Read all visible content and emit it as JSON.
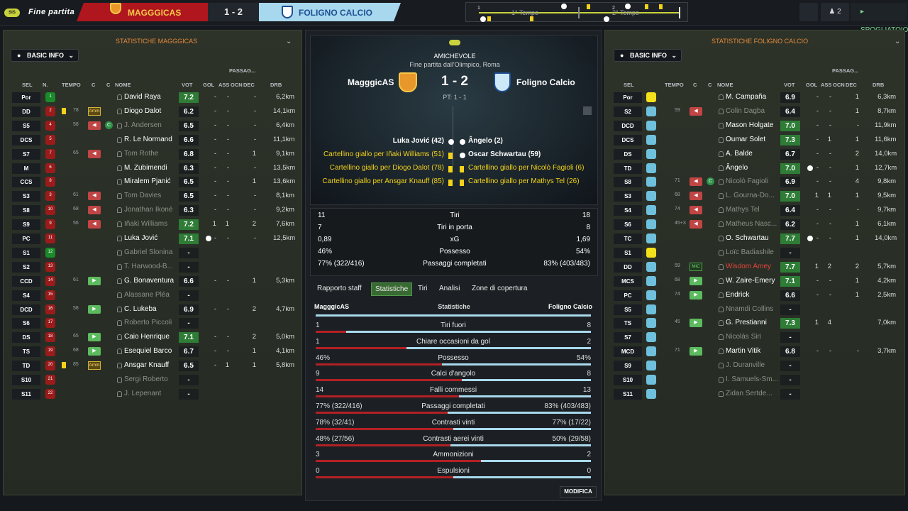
{
  "topbar": {
    "logo_text": "SIS",
    "stage": "Fine partita",
    "home_team": "MAGGGICAS",
    "score": "1 - 2",
    "away_team": "FOLIGNO CALCIO",
    "first_half": "1° Tempo",
    "second_half": "2° Tempo",
    "half_marks": [
      "1",
      "2"
    ],
    "squad_count": "2",
    "dressing_room": "SPOGLIATOIO"
  },
  "left_panel": {
    "title": "STATISTICHE MAGGGICAS",
    "basic_info": "BASIC INFO",
    "headers": {
      "sel": "SEL",
      "n": "N.",
      "tempo": "TEMPO",
      "c1": "C",
      "c2": "C",
      "nome": "NOME",
      "vot": "VOT",
      "passag": "PASSAG...",
      "gol": "GOL",
      "ass": "ASS",
      "ocn": "OCN",
      "dec": "DEC",
      "drb": "DRB"
    },
    "rows": [
      {
        "pos": "Por",
        "n": "1",
        "name": "David Raya",
        "vot": "7.2",
        "gol": "-",
        "ass": "-",
        "dec": "-",
        "drb": "6,2km",
        "dim": false,
        "hi": true,
        "gk": true
      },
      {
        "pos": "DD",
        "n": "2",
        "min": "78",
        "card": true,
        "tag": "Amm",
        "name": "Diogo Dalot",
        "vot": "6.2",
        "gol": "-",
        "ass": "-",
        "dec": "-",
        "drb": "14,1km",
        "dim": false
      },
      {
        "pos": "S5",
        "n": "4",
        "sub": "out",
        "min": "58",
        "btn": "out",
        "cicon": true,
        "cicon_text": "C",
        "name": "J. Andersen",
        "vot": "6.5",
        "gol": "-",
        "ass": "-",
        "dec": "-",
        "drb": "6,4km",
        "dim": true
      },
      {
        "pos": "DCS",
        "n": "5",
        "name": "R. Le Normand",
        "vot": "6.6",
        "gol": "-",
        "ass": "-",
        "dec": "-",
        "drb": "11,1km",
        "dim": false
      },
      {
        "pos": "S7",
        "n": "7",
        "sub": "out",
        "min": "65",
        "btn": "out",
        "name": "Tom Rothe",
        "vot": "6.8",
        "gol": "-",
        "ass": "-",
        "dec": "1",
        "drb": "9,1km",
        "dim": true
      },
      {
        "pos": "M",
        "n": "6",
        "name": "M. Zubimendi",
        "vot": "6.3",
        "gol": "-",
        "ass": "-",
        "dec": "-",
        "drb": "13,5km",
        "dim": false
      },
      {
        "pos": "CCS",
        "n": "8",
        "name": "Miralem Pjanić",
        "vot": "6.5",
        "gol": "-",
        "ass": "-",
        "dec": "1",
        "drb": "13,6km",
        "dim": false
      },
      {
        "pos": "S3",
        "n": "3",
        "sub": "out",
        "min": "61",
        "btn": "out",
        "name": "Tom Davies",
        "vot": "6.5",
        "gol": "-",
        "ass": "-",
        "dec": "-",
        "drb": "8,1km",
        "dim": true
      },
      {
        "pos": "S8",
        "n": "10",
        "sub": "out",
        "min": "68",
        "btn": "out",
        "name": "Jonathan Ikoné",
        "vot": "6.3",
        "gol": "-",
        "ass": "-",
        "dec": "-",
        "drb": "9,2km",
        "dim": true
      },
      {
        "pos": "S9",
        "n": "9",
        "sub": "out",
        "min": "56",
        "btn": "out",
        "name": "Iñaki Williams",
        "vot": "7.2",
        "gol": "1",
        "ass": "1",
        "dec": "2",
        "drb": "7,6km",
        "dim": true,
        "hi": true
      },
      {
        "pos": "PC",
        "n": "11",
        "ball": true,
        "name": "Luka Jović",
        "vot": "7.1",
        "gol": "-",
        "ass": "-",
        "dec": "-",
        "drb": "12,5km",
        "dim": false,
        "hi": true
      },
      {
        "pos": "S1",
        "n": "12",
        "name": "Gabriel Slonina",
        "vot": "-",
        "gol": "",
        "ass": "",
        "dec": "",
        "drb": "",
        "dim": true,
        "gk": true
      },
      {
        "pos": "S2",
        "n": "13",
        "name": "T. Harwood-B...",
        "vot": "-",
        "gol": "",
        "ass": "",
        "dec": "",
        "drb": "",
        "dim": true
      },
      {
        "pos": "CCD",
        "n": "14",
        "sub": "in",
        "min": "61",
        "btn": "in",
        "name": "G. Bonaventura",
        "vot": "6.6",
        "gol": "-",
        "ass": "-",
        "dec": "1",
        "drb": "5,3km",
        "dim": false
      },
      {
        "pos": "S4",
        "n": "15",
        "name": "Alassane Pléa",
        "vot": "-",
        "gol": "",
        "ass": "",
        "dec": "",
        "drb": "",
        "dim": true
      },
      {
        "pos": "DCD",
        "n": "16",
        "sub": "in",
        "min": "58",
        "btn": "in",
        "name": "C. Lukeba",
        "vot": "6.9",
        "gol": "-",
        "ass": "-",
        "dec": "2",
        "drb": "4,7km",
        "dim": false
      },
      {
        "pos": "S6",
        "n": "17",
        "name": "Roberto Piccoli",
        "vot": "-",
        "gol": "",
        "ass": "",
        "dec": "",
        "drb": "",
        "dim": true
      },
      {
        "pos": "DS",
        "n": "18",
        "sub": "in",
        "min": "65",
        "btn": "in",
        "name": "Caio Henrique",
        "vot": "7.1",
        "gol": "-",
        "ass": "-",
        "dec": "2",
        "drb": "5,0km",
        "dim": false,
        "hi": true
      },
      {
        "pos": "TS",
        "n": "19",
        "sub": "in",
        "min": "68",
        "btn": "in",
        "name": "Esequiel Barco",
        "vot": "6.7",
        "gol": "-",
        "ass": "-",
        "dec": "1",
        "drb": "4,1km",
        "dim": false
      },
      {
        "pos": "TD",
        "n": "20",
        "sub": "in",
        "min": "85",
        "card": true,
        "tag": "Amm",
        "name": "Ansgar Knauff",
        "vot": "6.5",
        "gol": "-",
        "ass": "1",
        "dec": "1",
        "drb": "5,8km",
        "dim": false
      },
      {
        "pos": "S10",
        "n": "21",
        "name": "Sergi Roberto",
        "vot": "-",
        "gol": "",
        "ass": "",
        "dec": "",
        "drb": "",
        "dim": true
      },
      {
        "pos": "S11",
        "n": "22",
        "name": "J. Lepenant",
        "vot": "-",
        "gol": "",
        "ass": "",
        "dec": "",
        "drb": "",
        "dim": true
      }
    ]
  },
  "right_panel": {
    "title": "STATISTICHE FOLIGNO CALCIO",
    "basic_info": "BASIC INFO",
    "headers": {
      "sel": "SEL",
      "tempo": "TEMPO",
      "c1": "C",
      "c2": "C",
      "nome": "NOME",
      "vot": "VOT",
      "passag": "PASSAG...",
      "gol": "GOL",
      "ass": "ASS",
      "ocn": "OCN",
      "dec": "DEC",
      "drb": "DRB"
    },
    "rows": [
      {
        "pos": "Por",
        "gk": true,
        "name": "M. Campaña",
        "vot": "6.9",
        "gol": "-",
        "ass": "-",
        "dec": "1",
        "drb": "6,3km",
        "dim": false
      },
      {
        "pos": "S2",
        "sub": "out",
        "min": "59",
        "btn": "out",
        "name": "Colin Dagba",
        "vot": "6.4",
        "gol": "-",
        "ass": "-",
        "dec": "1",
        "drb": "8,7km",
        "dim": true
      },
      {
        "pos": "DCD",
        "name": "Mason Holgate",
        "vot": "7.0",
        "gol": "-",
        "ass": "-",
        "dec": "-",
        "drb": "11,9km",
        "dim": false,
        "hi": true
      },
      {
        "pos": "DCS",
        "name": "Oumar Solet",
        "vot": "7.3",
        "gol": "-",
        "ass": "1",
        "dec": "1",
        "drb": "11,6km",
        "dim": false,
        "hi": true
      },
      {
        "pos": "DS",
        "name": "A. Balde",
        "vot": "6.7",
        "gol": "-",
        "ass": "-",
        "dec": "2",
        "drb": "14,0km",
        "dim": false
      },
      {
        "pos": "TD",
        "ball": true,
        "name": "Ângelo",
        "vot": "7.0",
        "gol": "-",
        "ass": "-",
        "dec": "1",
        "drb": "12,7km",
        "dim": false,
        "hi": true
      },
      {
        "pos": "S8",
        "sub": "out",
        "min": "71",
        "btn": "out",
        "cicon": true,
        "cicon_text": "C",
        "name": "Nicolò Fagioli",
        "vot": "6.9",
        "gol": "-",
        "ass": "-",
        "dec": "4",
        "drb": "9,8km",
        "dim": true
      },
      {
        "pos": "S3",
        "sub": "out",
        "min": "68",
        "btn": "out",
        "name": "L. Gourna-Do...",
        "vot": "7.0",
        "gol": "1",
        "ass": "1",
        "dec": "1",
        "drb": "9,5km",
        "dim": true,
        "hi": true
      },
      {
        "pos": "S4",
        "sub": "out",
        "min": "74",
        "btn": "out",
        "name": "Mathys Tel",
        "vot": "6.4",
        "gol": "-",
        "ass": "-",
        "dec": "-",
        "drb": "9,7km",
        "dim": true
      },
      {
        "pos": "S6",
        "sub": "out",
        "min": "45+3",
        "btn": "out",
        "name": "Matheus Nasc...",
        "vot": "6.2",
        "gol": "-",
        "ass": "-",
        "dec": "1",
        "drb": "6,1km",
        "dim": true
      },
      {
        "pos": "TC",
        "ball": true,
        "name": "O. Schwartau",
        "vot": "7.7",
        "gol": "-",
        "ass": "-",
        "dec": "1",
        "drb": "14,0km",
        "dim": false,
        "hi": true
      },
      {
        "pos": "S1",
        "gk": true,
        "name": "Loïc Badiashile",
        "vot": "-",
        "gol": "",
        "ass": "",
        "dec": "",
        "drb": "",
        "dim": true
      },
      {
        "pos": "DD",
        "sub": "in",
        "min": "59",
        "tag": "MiC",
        "name": "Wisdom Amey",
        "vot": "7.7",
        "gol": "1",
        "ass": "2",
        "dec": "2",
        "drb": "5,7km",
        "dim": false,
        "red": true,
        "hi": true
      },
      {
        "pos": "MCS",
        "sub": "in",
        "min": "68",
        "btn": "in",
        "name": "W. Zaire-Emery",
        "vot": "7.1",
        "gol": "-",
        "ass": "-",
        "dec": "1",
        "drb": "4,2km",
        "dim": false,
        "hi": true
      },
      {
        "pos": "PC",
        "sub": "in",
        "min": "74",
        "btn": "in",
        "name": "Endrick",
        "vot": "6.6",
        "gol": "-",
        "ass": "-",
        "dec": "1",
        "drb": "2,5km",
        "dim": false
      },
      {
        "pos": "S5",
        "name": "Nnamdi Collins",
        "vot": "-",
        "gol": "",
        "ass": "",
        "dec": "",
        "drb": "",
        "dim": true
      },
      {
        "pos": "TS",
        "sub": "in",
        "min": "45",
        "btn": "in",
        "name": "G. Prestianni",
        "vot": "7.3",
        "gol": "1",
        "ass": "4",
        "dec": "",
        "drb": "7,0km",
        "dim": false,
        "hi": true
      },
      {
        "pos": "S7",
        "name": "Nicolás Siri",
        "vot": "-",
        "gol": "",
        "ass": "",
        "dec": "",
        "drb": "",
        "dim": true
      },
      {
        "pos": "MCD",
        "sub": "in",
        "min": "71",
        "btn": "in",
        "name": "Martin Vitik",
        "vot": "6.8",
        "gol": "-",
        "ass": "-",
        "dec": "-",
        "drb": "3,7km",
        "dim": false
      },
      {
        "pos": "S9",
        "name": "J. Duranville",
        "vot": "-",
        "gol": "",
        "ass": "",
        "dec": "",
        "drb": "",
        "dim": true
      },
      {
        "pos": "S10",
        "name": "I. Samuels-Sm...",
        "vot": "-",
        "gol": "",
        "ass": "",
        "dec": "",
        "drb": "",
        "dim": true
      },
      {
        "pos": "S11",
        "name": "Zidan Sertde...",
        "vot": "-",
        "gol": "",
        "ass": "",
        "dec": "",
        "drb": "",
        "dim": true
      }
    ]
  },
  "center": {
    "competition": "AMICHEVOLE",
    "venue": "Fine partita dall'Olimpico, Roma",
    "home_name": "MagggicAS",
    "away_name": "Foligno Calcio",
    "score": "1 - 2",
    "ht": "PT: 1 - 1",
    "events_left": [
      "Luka Jović (42)",
      "Cartellino giallo per Iñaki Williams (51)",
      "Cartellino giallo per Diogo Dalot (78)",
      "Cartellino giallo per Ansgar Knauff (85)"
    ],
    "events_right": [
      "Ângelo (2)",
      "Oscar Schwartau (59)",
      "Cartellino giallo per Nicolò Fagioli (6)",
      "Cartellino giallo per Mathys Tel (26)"
    ],
    "summary": [
      {
        "l": "11",
        "label": "Tiri",
        "r": "18"
      },
      {
        "l": "7",
        "label": "Tiri in porta",
        "r": "8"
      },
      {
        "l": "0,89",
        "label": "xG",
        "r": "1,69"
      },
      {
        "l": "46%",
        "label": "Possesso",
        "r": "54%"
      },
      {
        "l": "77% (322/416)",
        "label": "Passaggi completati",
        "r": "83% (403/483)"
      }
    ],
    "tabs": [
      "Rapporto staff",
      "Statistiche",
      "Tiri",
      "Analisi",
      "Zone di copertura"
    ],
    "stats_header": {
      "home": "MagggicAS",
      "title": "Statistiche",
      "away": "Foligno Calcio"
    },
    "stats": [
      {
        "l": "1",
        "label": "Tiri fuori",
        "r": "8",
        "lv": 0.11
      },
      {
        "l": "1",
        "label": "Chiare occasioni da gol",
        "r": "2",
        "lv": 0.33
      },
      {
        "l": "46%",
        "label": "Possesso",
        "r": "54%",
        "lv": 0.46
      },
      {
        "l": "9",
        "label": "Calci d'angolo",
        "r": "8",
        "lv": 0.53
      },
      {
        "l": "14",
        "label": "Falli commessi",
        "r": "13",
        "lv": 0.52
      },
      {
        "l": "77% (322/416)",
        "label": "Passaggi completati",
        "r": "83% (403/483)",
        "lv": 0.48
      },
      {
        "l": "78% (32/41)",
        "label": "Contrasti vinti",
        "r": "77% (17/22)",
        "lv": 0.5
      },
      {
        "l": "48% (27/56)",
        "label": "Contrasti aerei vinti",
        "r": "50% (29/58)",
        "lv": 0.49
      },
      {
        "l": "3",
        "label": "Ammonizioni",
        "r": "2",
        "lv": 0.6
      },
      {
        "l": "0",
        "label": "Espulsioni",
        "r": "0",
        "lv": 0.5
      }
    ],
    "modifica": "MODIFICA"
  },
  "colors": {
    "home": "#b0161d",
    "away": "#a7d8ee",
    "accent": "#c8d23c",
    "high_vote": "#2e7c36"
  }
}
